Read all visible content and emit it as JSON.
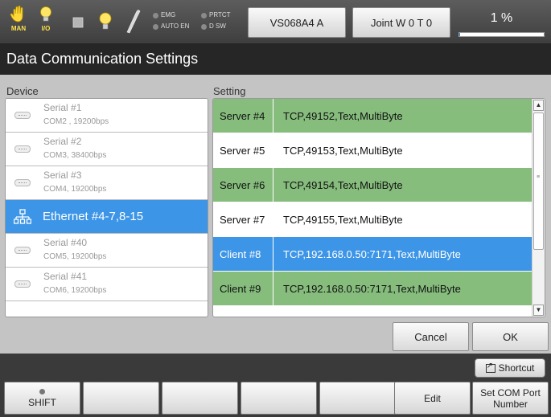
{
  "statusbar": {
    "man_caption": "MAN",
    "io_caption": "I/O",
    "leds_left": [
      "EMG",
      "AUTO EN"
    ],
    "leds_right": [
      "PRTCT",
      "D SW"
    ],
    "robot_button": "VS068A4 A",
    "joint_button": "Joint W 0 T 0",
    "speed_text": "1 %",
    "speed_value": 1,
    "accent_color": "#2d7dd2"
  },
  "title": "Data Communication Settings",
  "device": {
    "label": "Device",
    "items": [
      {
        "name": "Serial #1",
        "sub": "COM2 , 19200bps",
        "icon": "serial-port-icon"
      },
      {
        "name": "Serial #2",
        "sub": "COM3, 38400bps",
        "icon": "serial-port-icon"
      },
      {
        "name": "Serial #3",
        "sub": "COM4, 19200bps",
        "icon": "serial-port-icon"
      },
      {
        "name": "Ethernet #4-7,8-15",
        "sub": "",
        "icon": "network-icon",
        "selected": true
      },
      {
        "name": "Serial #40",
        "sub": "COM5, 19200bps",
        "icon": "serial-port-icon"
      },
      {
        "name": "Serial #41",
        "sub": "COM6, 19200bps",
        "icon": "serial-port-icon"
      }
    ]
  },
  "setting": {
    "label": "Setting",
    "rows": [
      {
        "name": "Server #4",
        "value": "TCP,49152,Text,MultiByte",
        "style": "green"
      },
      {
        "name": "Server #5",
        "value": "TCP,49153,Text,MultiByte",
        "style": "plain"
      },
      {
        "name": "Server #6",
        "value": "TCP,49154,Text,MultiByte",
        "style": "green"
      },
      {
        "name": "Server #7",
        "value": "TCP,49155,Text,MultiByte",
        "style": "plain"
      },
      {
        "name": "Client #8",
        "value": "TCP,192.168.0.50:7171,Text,MultiByte",
        "style": "sel"
      },
      {
        "name": "Client #9",
        "value": "TCP,192.168.0.50:7171,Text,MultiByte",
        "style": "green"
      }
    ],
    "row_green_color": "#86bd7d",
    "row_selected_color": "#3c95e6"
  },
  "dialog": {
    "cancel": "Cancel",
    "ok": "OK"
  },
  "bottom": {
    "shortcut": "Shortcut",
    "fkeys": [
      "SHIFT",
      "",
      "",
      "",
      "",
      "Edit",
      "Set COM Port Number"
    ]
  }
}
